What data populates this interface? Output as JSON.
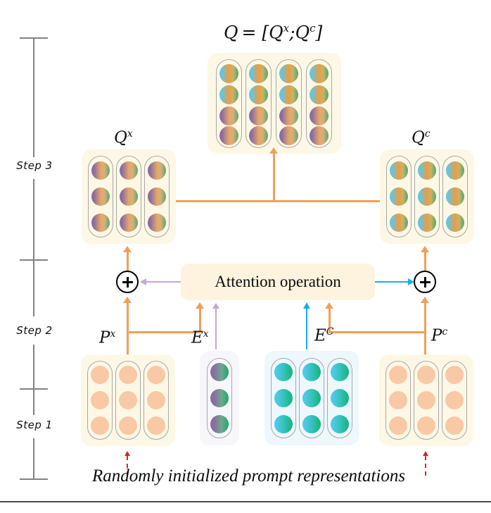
{
  "figure": {
    "caption": "Randomly initialized prompt representations",
    "attention_box_label": "Attention operation"
  },
  "timeline": {
    "steps": [
      {
        "label": "Step 3"
      },
      {
        "label": "Step 2"
      },
      {
        "label": "Step 1"
      }
    ]
  },
  "blocks": {
    "q_combined": {
      "label_parts": {
        "lhs": "Q",
        "eq": "= [",
        "qx": "Q",
        "qx_sup": "x",
        "sep": ";",
        "qc": "Q",
        "qc_sup": "c",
        "rhs": "]"
      },
      "label_text": "Q = [Q x ; Q c ]",
      "columns": 4,
      "rows": 4,
      "dot_style_top_rows": "cyan-orange-green",
      "row_styles": [
        "coy",
        "coy",
        "poy",
        "poy"
      ]
    },
    "qx": {
      "base": "Q",
      "sup": "x",
      "columns": 3,
      "rows": 3,
      "dot_style": "purple-orange-green"
    },
    "qc": {
      "base": "Q",
      "sup": "c",
      "columns": 3,
      "rows": 3,
      "dot_style": "cyan-orange-green"
    },
    "px": {
      "base": "P",
      "sup": "x",
      "columns": 3,
      "rows": 3,
      "dot_style": "solid-orange"
    },
    "ex": {
      "base": "E",
      "sup": "x",
      "columns": 1,
      "rows": 3,
      "dot_style": "purple-green"
    },
    "ec": {
      "base": "E",
      "sup": "C",
      "columns": 3,
      "rows": 3,
      "dot_style": "cyan-green"
    },
    "pc": {
      "base": "P",
      "sup": "c",
      "columns": 3,
      "rows": 3,
      "dot_style": "solid-orange"
    }
  },
  "operators": {
    "add_left": "+",
    "add_right": "+"
  },
  "colors": {
    "orange_flow": "#f0a058",
    "purple_flow": "#c4a7d8",
    "cyan_flow": "#17aee8",
    "red_dashed": "#e02020",
    "panel_cream": "#fdf7e6",
    "panel_lavender": "#f7f7fb",
    "panel_blue": "#eef7fb",
    "dot_orange": "#f8c9a4",
    "axis_gray": "#808285"
  }
}
